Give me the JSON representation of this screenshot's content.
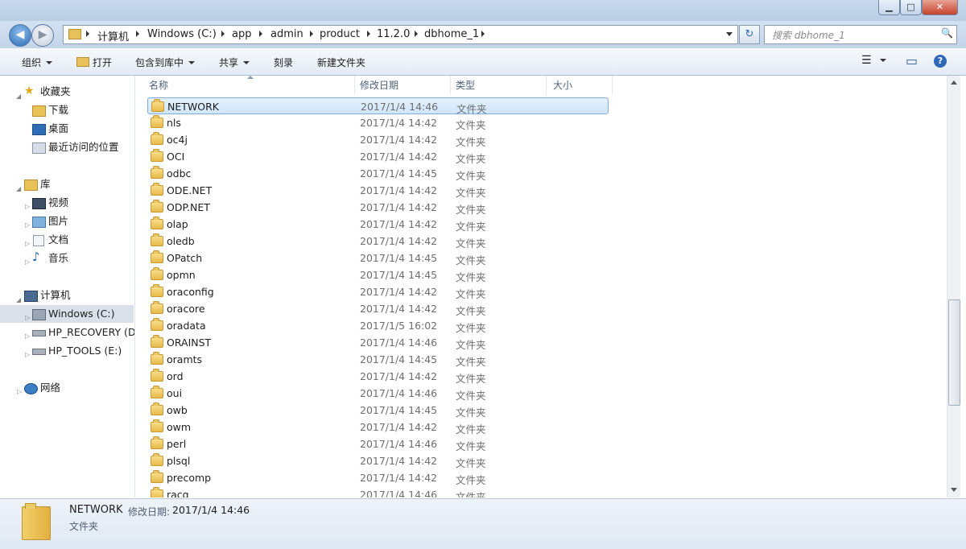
{
  "window": {
    "minimize": "▁",
    "maximize": "□",
    "close": "✕"
  },
  "nav": {
    "back": "◀",
    "forward": "▶",
    "refresh": "↻"
  },
  "address": {
    "crumbs": [
      "计算机",
      "Windows (C:)",
      "app",
      "admin",
      "product",
      "11.2.0",
      "dbhome_1"
    ]
  },
  "search": {
    "placeholder": "搜索 dbhome_1",
    "icon": "🔍"
  },
  "toolbar": {
    "organize": "组织",
    "open": "打开",
    "include_library": "包含到库中",
    "share": "共享",
    "burn": "刻录",
    "new_folder": "新建文件夹",
    "views": "☰",
    "preview": "▭",
    "help": "?"
  },
  "navpane": {
    "favorites": "收藏夹",
    "downloads": "下载",
    "desktop": "桌面",
    "recent": "最近访问的位置",
    "libraries": "库",
    "videos": "视频",
    "pictures": "图片",
    "documents": "文档",
    "music": "音乐",
    "computer": "计算机",
    "drive_c": "Windows  (C:)",
    "drive_d": "HP_RECOVERY (D:)",
    "drive_e": "HP_TOOLS (E:)",
    "network": "网络"
  },
  "columns": {
    "name": "名称",
    "date": "修改日期",
    "type": "类型",
    "size": "大小"
  },
  "files": [
    {
      "name": "NETWORK",
      "date": "2017/1/4 14:46",
      "type": "文件夹"
    },
    {
      "name": "nls",
      "date": "2017/1/4 14:42",
      "type": "文件夹"
    },
    {
      "name": "oc4j",
      "date": "2017/1/4 14:42",
      "type": "文件夹"
    },
    {
      "name": "OCI",
      "date": "2017/1/4 14:42",
      "type": "文件夹"
    },
    {
      "name": "odbc",
      "date": "2017/1/4 14:45",
      "type": "文件夹"
    },
    {
      "name": "ODE.NET",
      "date": "2017/1/4 14:42",
      "type": "文件夹"
    },
    {
      "name": "ODP.NET",
      "date": "2017/1/4 14:42",
      "type": "文件夹"
    },
    {
      "name": "olap",
      "date": "2017/1/4 14:42",
      "type": "文件夹"
    },
    {
      "name": "oledb",
      "date": "2017/1/4 14:42",
      "type": "文件夹"
    },
    {
      "name": "OPatch",
      "date": "2017/1/4 14:45",
      "type": "文件夹"
    },
    {
      "name": "opmn",
      "date": "2017/1/4 14:45",
      "type": "文件夹"
    },
    {
      "name": "oraconfig",
      "date": "2017/1/4 14:42",
      "type": "文件夹"
    },
    {
      "name": "oracore",
      "date": "2017/1/4 14:42",
      "type": "文件夹"
    },
    {
      "name": "oradata",
      "date": "2017/1/5 16:02",
      "type": "文件夹"
    },
    {
      "name": "ORAINST",
      "date": "2017/1/4 14:46",
      "type": "文件夹"
    },
    {
      "name": "oramts",
      "date": "2017/1/4 14:45",
      "type": "文件夹"
    },
    {
      "name": "ord",
      "date": "2017/1/4 14:42",
      "type": "文件夹"
    },
    {
      "name": "oui",
      "date": "2017/1/4 14:46",
      "type": "文件夹"
    },
    {
      "name": "owb",
      "date": "2017/1/4 14:45",
      "type": "文件夹"
    },
    {
      "name": "owm",
      "date": "2017/1/4 14:42",
      "type": "文件夹"
    },
    {
      "name": "perl",
      "date": "2017/1/4 14:46",
      "type": "文件夹"
    },
    {
      "name": "plsql",
      "date": "2017/1/4 14:42",
      "type": "文件夹"
    },
    {
      "name": "precomp",
      "date": "2017/1/4 14:42",
      "type": "文件夹"
    },
    {
      "name": "racg",
      "date": "2017/1/4 14:46",
      "type": "文件夹"
    }
  ],
  "details": {
    "name": "NETWORK",
    "date_label": "修改日期:",
    "date": "2017/1/4 14:46",
    "type": "文件夹"
  }
}
